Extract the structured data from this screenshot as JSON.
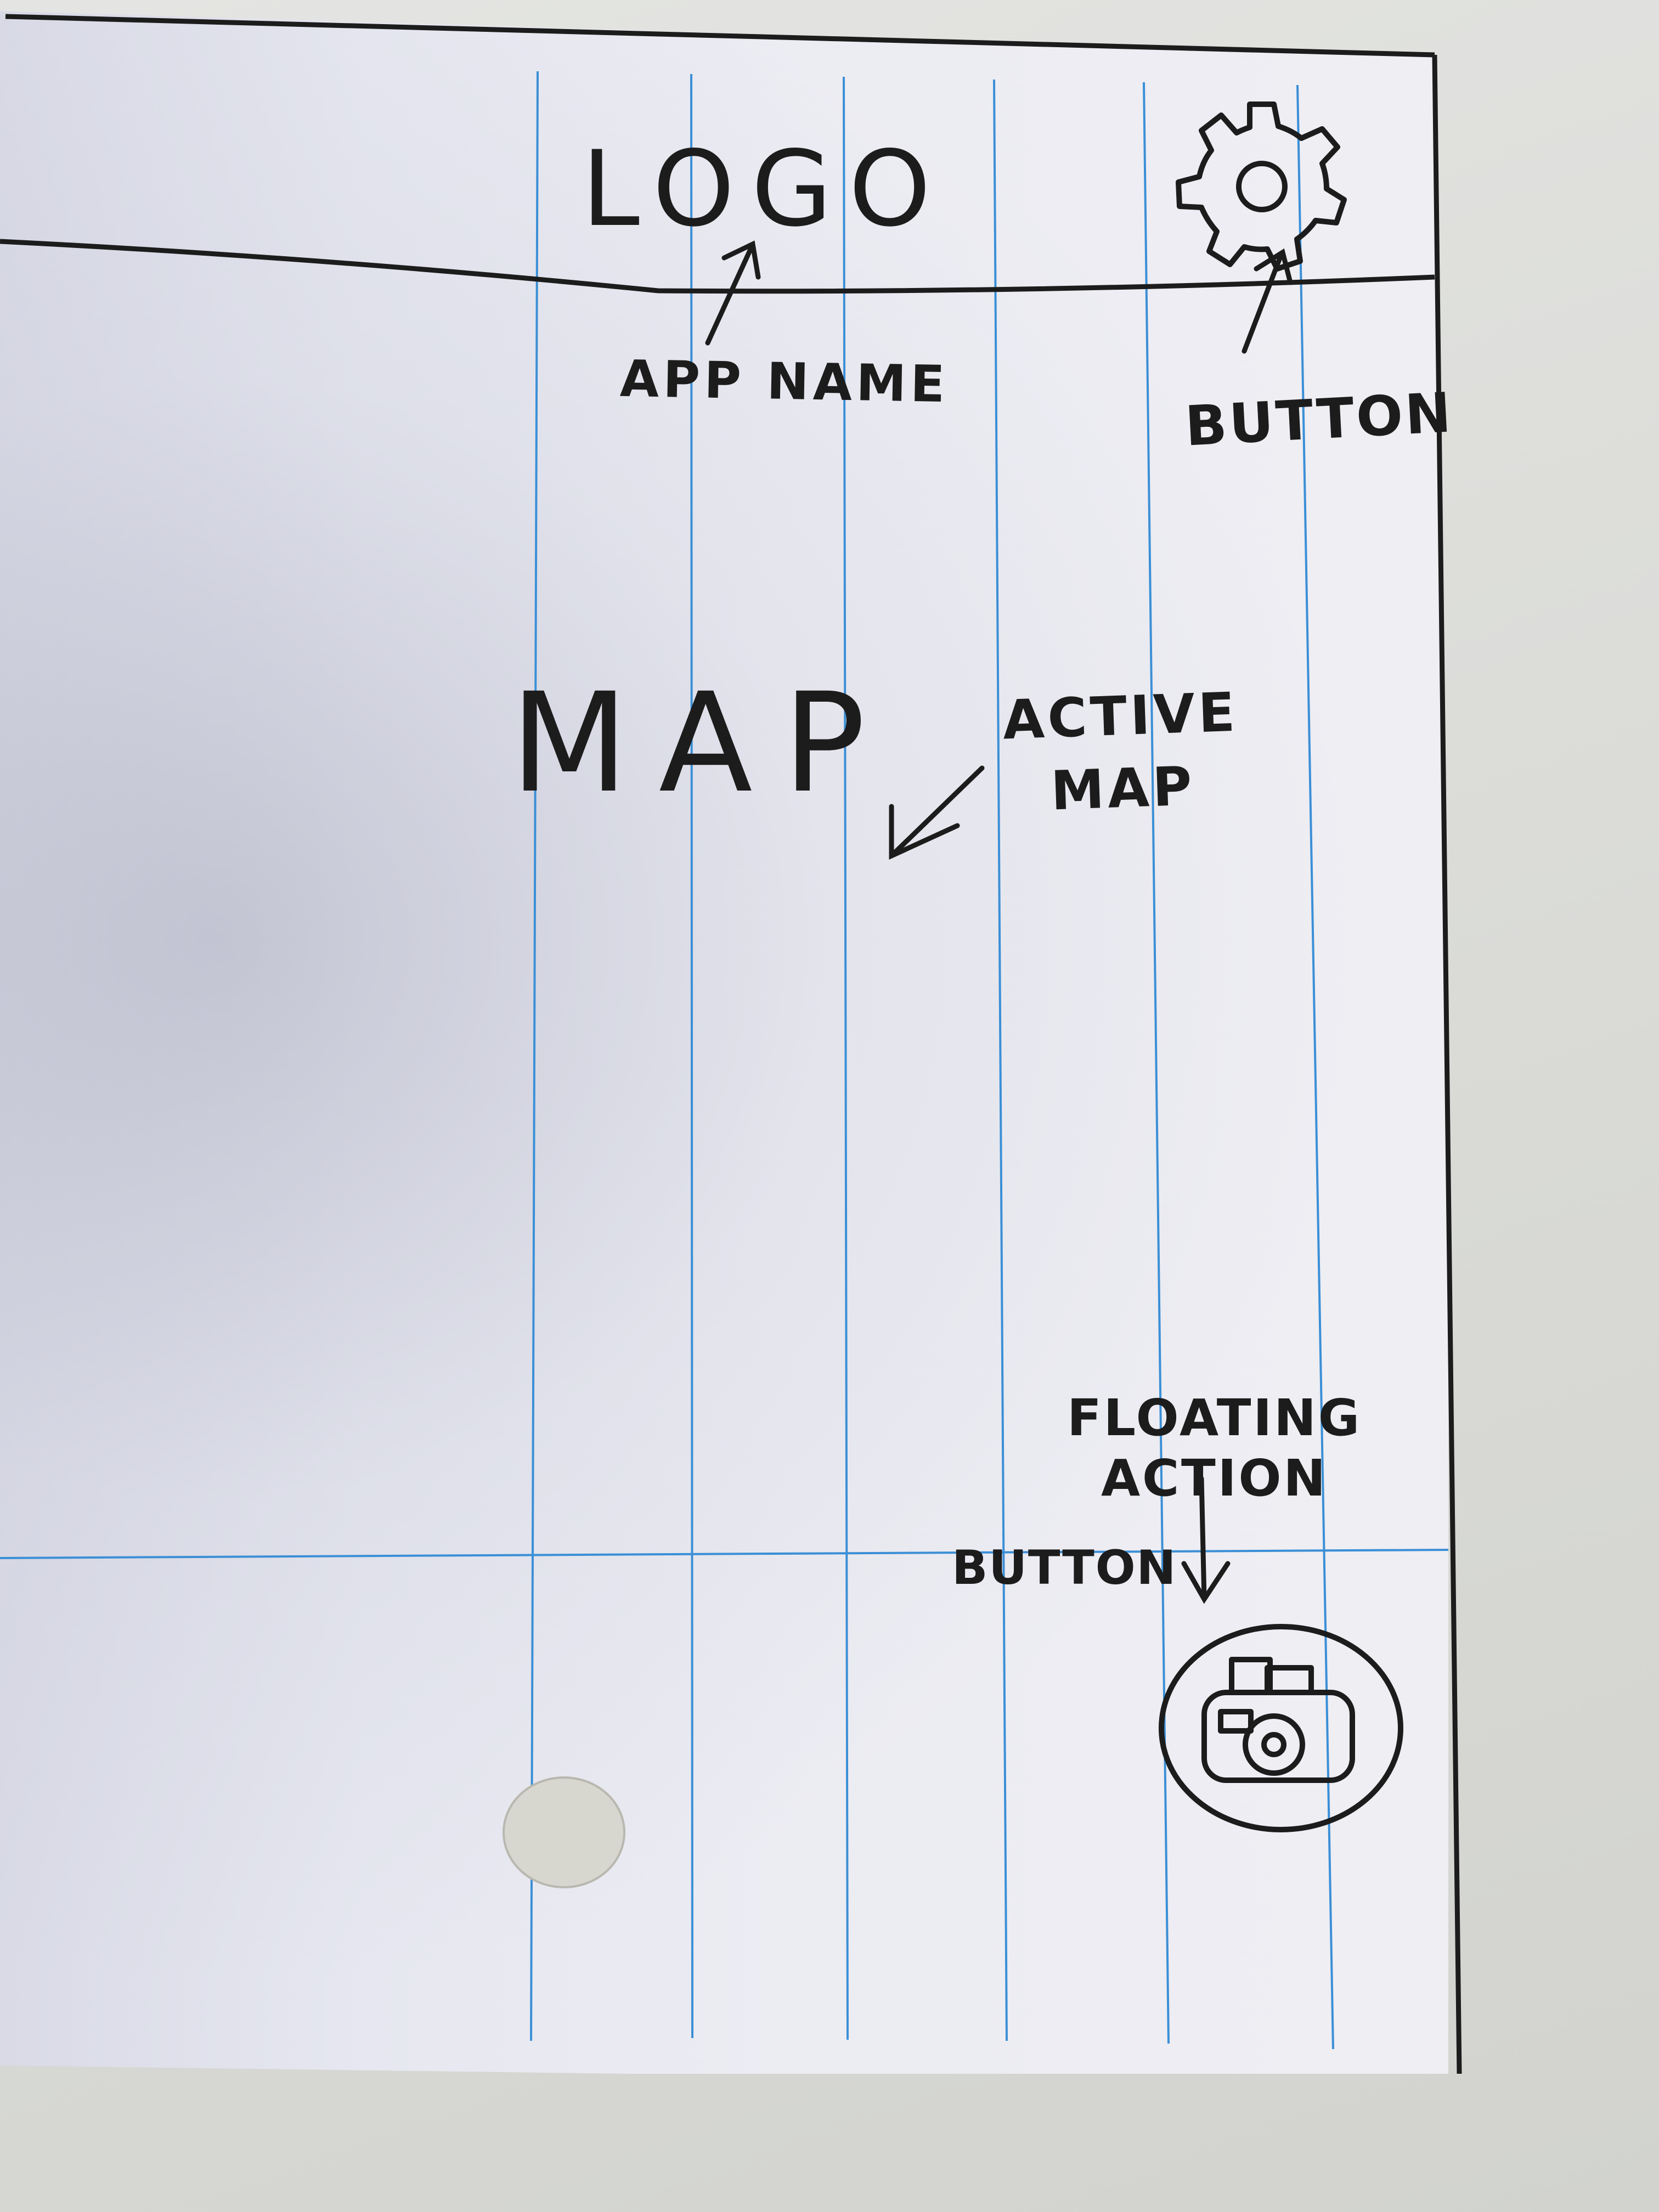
{
  "sketch": {
    "header": {
      "logo_text": "LOGO",
      "logo_annotation": "APP NAME",
      "settings_icon": "gear-icon",
      "settings_annotation": "BUTTON"
    },
    "body": {
      "map_text": "MAP",
      "map_annotation_line1": "ACTIVE",
      "map_annotation_line2": "MAP"
    },
    "fab": {
      "annotation_line1": "FLOATING",
      "annotation_line2": "ACTION",
      "annotation_line3": "BUTTON",
      "icon": "camera-icon"
    }
  },
  "colors": {
    "ink": "#1c1c1c",
    "ruled_line": "#3b8fd6",
    "paper": "#ececf3"
  }
}
